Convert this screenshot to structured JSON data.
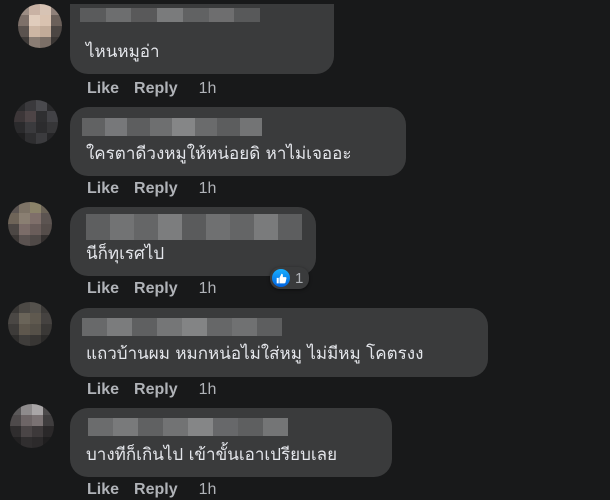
{
  "actions": {
    "like": "Like",
    "reply": "Reply"
  },
  "comments": [
    {
      "text": "ไหนหมูอ่า",
      "time": "1h"
    },
    {
      "text": "ใครตาดีวงหมูให้หน่อยดิ หาไม่เจออะ",
      "time": "1h"
    },
    {
      "text": "นีก็ทุเรศไป",
      "time": "1h",
      "reaction": {
        "icon": "like-icon",
        "count": "1"
      }
    },
    {
      "text": "แถวบ้านผม หมกหน่อไม่ใส่หมู ไม่มีหมู โคตรงง",
      "time": "1h"
    },
    {
      "text": "บางทีก็เกินไป เข้าขั้นเอาเปรียบเลย",
      "time": "1h"
    }
  ],
  "colors": {
    "background": "#18191a",
    "bubble": "#3a3b3c",
    "text": "#e4e6eb",
    "secondary_text": "#b0b3b8",
    "like_blue": "#1877f2"
  }
}
